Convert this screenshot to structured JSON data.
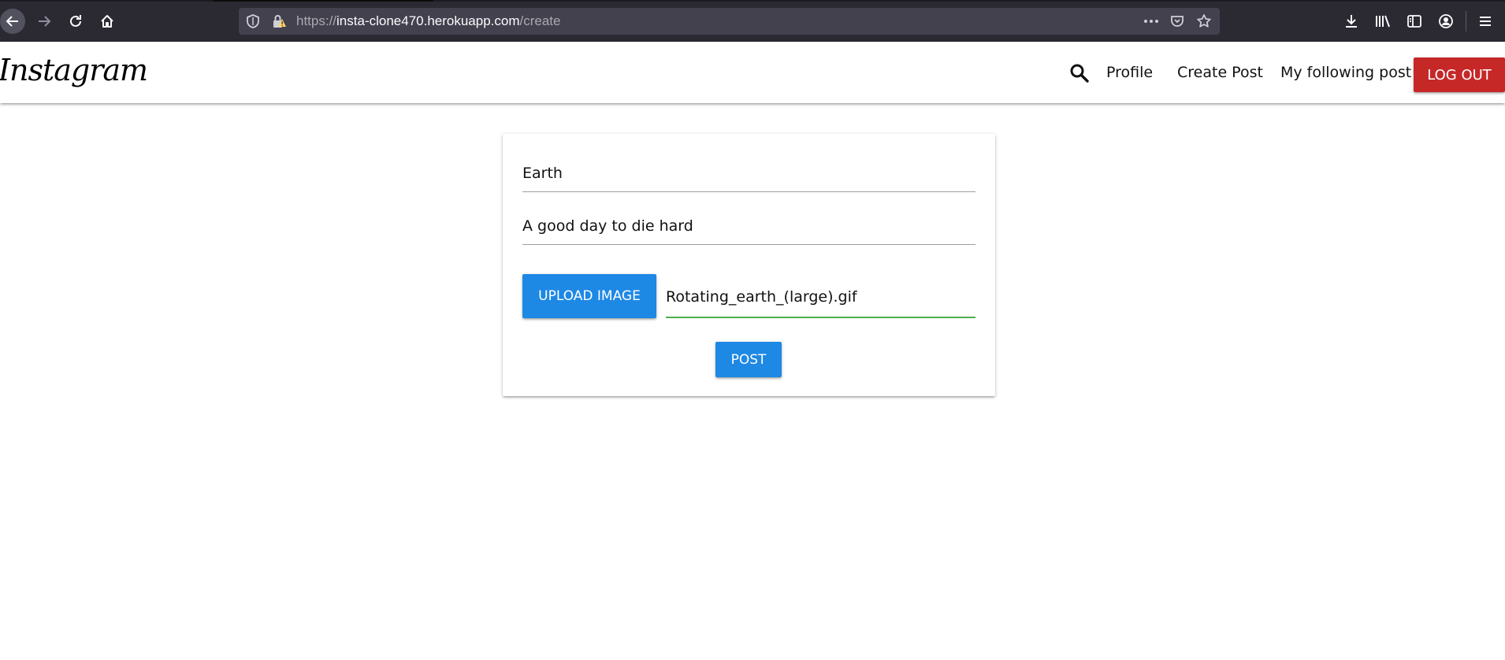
{
  "browser": {
    "url_scheme": "https://",
    "url_host": "insta-clone470.herokuapp.com",
    "url_path": "/create"
  },
  "navbar": {
    "brand": "Instagram",
    "links": {
      "profile": "Profile",
      "create_post": "Create Post",
      "my_following_post": "My following post"
    },
    "logout_label": "LOG OUT"
  },
  "create_form": {
    "title_value": "Earth",
    "body_value": "A good day to die hard",
    "upload_label": "UPLOAD IMAGE",
    "file_name": "Rotating_earth_(large).gif",
    "post_label": "POST"
  },
  "colors": {
    "browser_toolbar": "#2b2a33",
    "urlbar": "#42414d",
    "primary_button": "#1e88e5",
    "logout_button": "#c62828",
    "file_path_underline": "#4caf50"
  },
  "icons": [
    "back-arrow-icon",
    "forward-arrow-icon",
    "reload-icon",
    "home-icon",
    "shield-icon",
    "insecure-lock-icon",
    "more-icon",
    "pocket-icon",
    "bookmark-star-icon",
    "download-icon",
    "library-icon",
    "sidebar-icon",
    "account-icon",
    "menu-icon",
    "search-icon"
  ]
}
